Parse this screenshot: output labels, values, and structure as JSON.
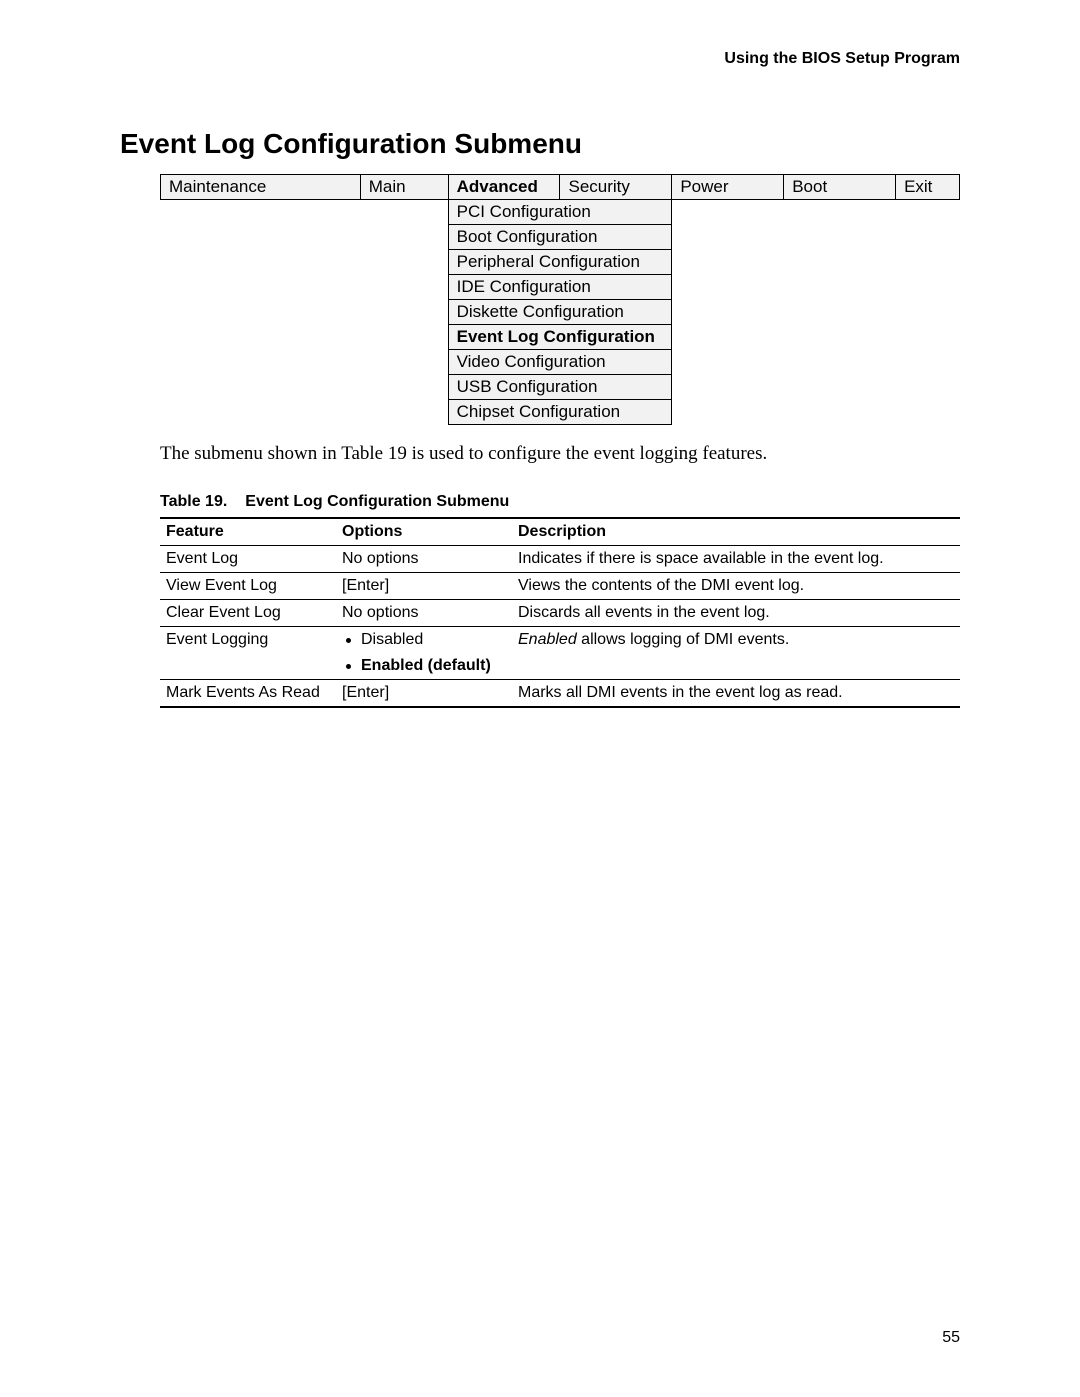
{
  "header": {
    "running": "Using the BIOS Setup Program"
  },
  "title": "Event Log Configuration Submenu",
  "menu": {
    "tabs": [
      "Maintenance",
      "Main",
      "Advanced",
      "Security",
      "Power",
      "Boot",
      "Exit"
    ],
    "active_index": 2,
    "submenu": [
      "PCI Configuration",
      "Boot Configuration",
      "Peripheral Configuration",
      "IDE Configuration",
      "Diskette Configuration",
      "Event Log Configuration",
      "Video Configuration",
      "USB Configuration",
      "Chipset Configuration"
    ],
    "submenu_bold_index": 5
  },
  "paragraph": "The submenu shown in Table 19 is used to configure the event logging features.",
  "table_caption_num": "Table 19.",
  "table_caption_title": "Event Log Configuration Submenu",
  "feat_headers": [
    "Feature",
    "Options",
    "Description"
  ],
  "feat_rows": [
    {
      "feature": "Event Log",
      "options": [
        {
          "text": "No options",
          "bullet": false
        }
      ],
      "description": "Indicates if there is space available in the event log."
    },
    {
      "feature": "View Event Log",
      "options": [
        {
          "text": "[Enter]",
          "bullet": false
        }
      ],
      "description": "Views the contents of the DMI event log."
    },
    {
      "feature": "Clear Event Log",
      "options": [
        {
          "text": "No options",
          "bullet": false
        }
      ],
      "description": "Discards all events in the event log."
    },
    {
      "feature": "Event Logging",
      "options": [
        {
          "text": "Disabled",
          "bullet": true
        },
        {
          "text": "Enabled (default)",
          "bullet": true,
          "bold": true
        }
      ],
      "description_italic_prefix": "Enabled",
      "description_rest": " allows logging of DMI events."
    },
    {
      "feature": "Mark Events As Read",
      "options": [
        {
          "text": "[Enter]",
          "bullet": false
        }
      ],
      "description": "Marks all DMI events in the event log as read."
    }
  ],
  "page_number": "55"
}
